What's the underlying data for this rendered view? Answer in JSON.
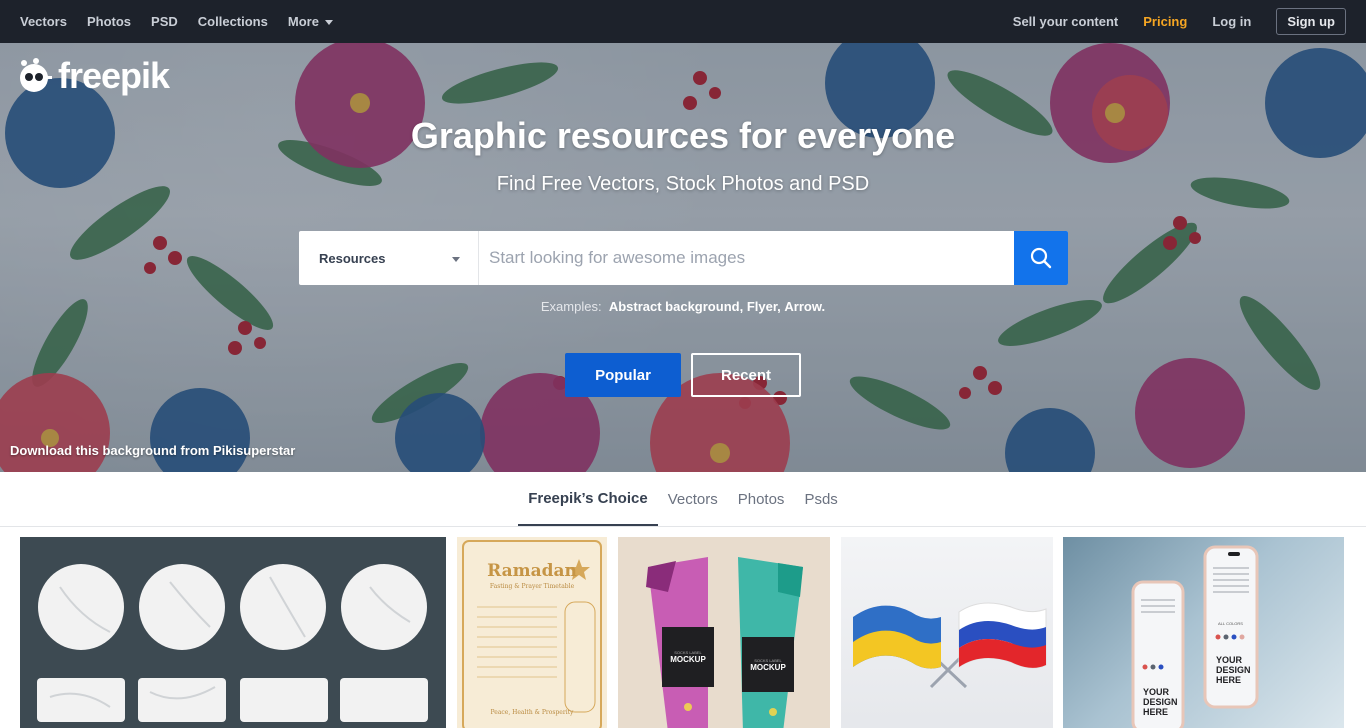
{
  "topnav": {
    "left": [
      "Vectors",
      "Photos",
      "PSD",
      "Collections",
      "More"
    ],
    "right": {
      "sell": "Sell your content",
      "pricing": "Pricing",
      "login": "Log in",
      "signup": "Sign up"
    }
  },
  "hero": {
    "logo_text": "freepik",
    "title": "Graphic resources for everyone",
    "subtitle": "Find Free Vectors, Stock Photos and PSD",
    "search": {
      "category": "Resources",
      "placeholder": "Start looking for awesome images"
    },
    "examples_label": "Examples:",
    "examples": [
      "Abstract background,",
      "Flyer,",
      "Arrow."
    ],
    "popular": "Popular",
    "recent": "Recent",
    "credit": "Download this background from Pikisuperstar"
  },
  "tabs": [
    "Freepik’s Choice",
    "Vectors",
    "Photos",
    "Psds"
  ],
  "gallery": {
    "ramadan_title": "Ramadan",
    "ramadan_sub": "Fasting & Prayer Timetable",
    "ramadan_footer": "Peace, Health & Prosperity",
    "socks_label": "SOCKS LABEL",
    "socks_mockup": "MOCKUP",
    "phone_text": [
      "YOUR",
      "DESIGN",
      "HERE"
    ],
    "phone_colors_label": "ALL COLORS"
  },
  "colors": {
    "nav_bg": "#1d222b",
    "accent_blue": "#1273eb",
    "pricing": "#f6a623"
  }
}
